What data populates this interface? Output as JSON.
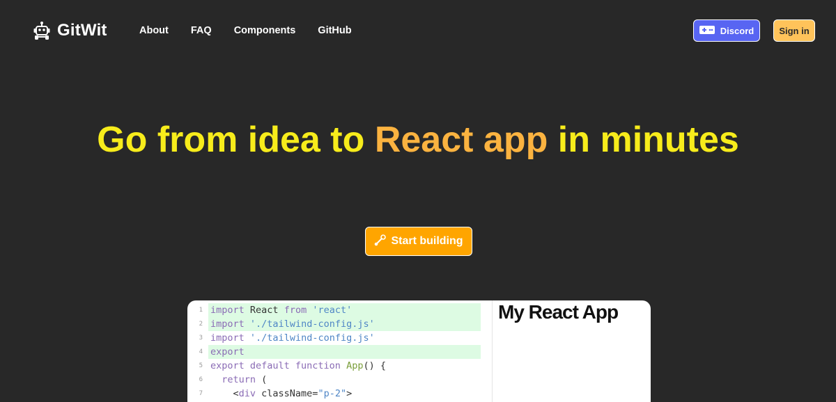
{
  "header": {
    "brand": "GitWit",
    "nav": [
      "About",
      "FAQ",
      "Components",
      "GitHub"
    ],
    "discord_label": "Discord",
    "signin_label": "Sign in"
  },
  "hero": {
    "title_part1": "Go from idea to ",
    "title_part2": "React app",
    "title_part3": " in minutes",
    "cta_label": "Start building"
  },
  "editor": {
    "lines": [
      {
        "n": "1",
        "highlight": true
      },
      {
        "n": "2",
        "highlight": true
      },
      {
        "n": "3",
        "highlight": false
      },
      {
        "n": "4",
        "highlight": true
      },
      {
        "n": "5",
        "highlight": false
      },
      {
        "n": "6",
        "highlight": false
      },
      {
        "n": "7",
        "highlight": false
      }
    ],
    "code": [
      [
        "import",
        " React ",
        "from",
        " ",
        "'react'"
      ],
      [
        "import",
        " ",
        "'./tailwind-config.js'"
      ],
      [
        "import",
        " ",
        "'./tailwind-config.js'"
      ],
      [
        "export"
      ],
      [
        "export default function",
        " ",
        "App",
        "() {"
      ],
      [
        "  ",
        "return",
        " ("
      ],
      [
        "    <",
        "div",
        " className=",
        "\"p-2\"",
        ">"
      ]
    ]
  },
  "preview": {
    "title": "My React App"
  },
  "colors": {
    "background": "#282828",
    "title_yellow": "#F7EC1B",
    "title_orange": "#FBB340",
    "cta": "#FFA500",
    "discord": "#5865F2",
    "signin": "#FFC35A",
    "highlight": "#DDFBE3"
  }
}
